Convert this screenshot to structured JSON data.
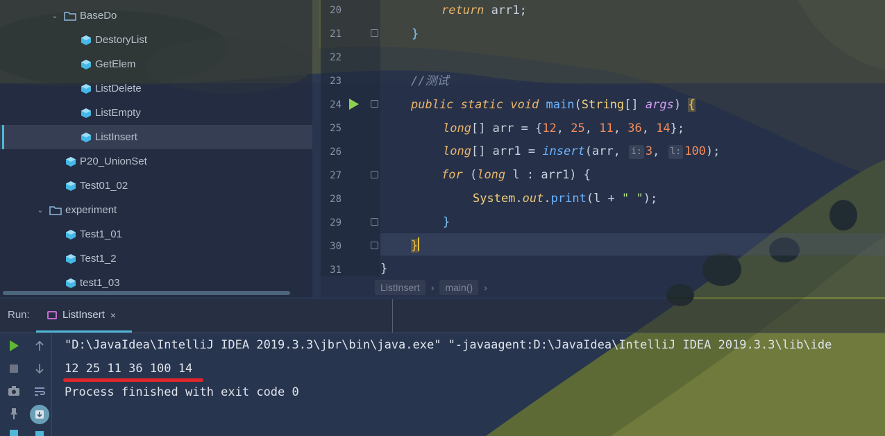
{
  "project_tree": {
    "items": [
      {
        "label": "BaseDo",
        "type": "folder",
        "expanded": true
      },
      {
        "label": "DestoryList",
        "type": "class"
      },
      {
        "label": "GetElem",
        "type": "class"
      },
      {
        "label": "ListDelete",
        "type": "class"
      },
      {
        "label": "ListEmpty",
        "type": "class"
      },
      {
        "label": "ListInsert",
        "type": "class",
        "selected": true
      },
      {
        "label": "P20_UnionSet",
        "type": "class"
      },
      {
        "label": "Test01_02",
        "type": "class"
      },
      {
        "label": "experiment",
        "type": "folder",
        "expanded": true
      },
      {
        "label": "Test1_01",
        "type": "class"
      },
      {
        "label": "Test1_2",
        "type": "class"
      },
      {
        "label": "test1_03",
        "type": "class"
      }
    ]
  },
  "editor": {
    "line_numbers": [
      "20",
      "21",
      "22",
      "23",
      "24",
      "25",
      "26",
      "27",
      "28",
      "29",
      "30",
      "31"
    ],
    "code": {
      "l20_kw": "return",
      "l20_rest": " arr1;",
      "l21": "}",
      "l23_comment": "//测试",
      "l24_public": "public",
      "l24_static": "static",
      "l24_void": "void",
      "l24_main": "main",
      "l24_string": "String",
      "l24_brackets": "[] ",
      "l24_args": "args",
      "l24_close": ") ",
      "l24_brace": "{",
      "l25_long": "long",
      "l25_decl": "[] arr = {",
      "l25_n1": "12",
      "l25_n2": "25",
      "l25_n3": "11",
      "l25_n4": "36",
      "l25_n5": "14",
      "l25_end": "};",
      "l26_long": "long",
      "l26_decl": "[] arr1 = ",
      "l26_insert": "insert",
      "l26_args": "(arr, ",
      "l26_hint_i": "i:",
      "l26_n1": "3",
      "l26_hint_l": "l:",
      "l26_n2": "100",
      "l26_end": ");",
      "l27_for": "for",
      "l27_open": " (",
      "l27_long": "long",
      "l27_rest": " l : arr1) {",
      "l28_system": "System",
      "l28_dot": ".",
      "l28_out": "out",
      "l28_print": "print",
      "l28_open": "(l + ",
      "l28_str": "\" \"",
      "l28_end": ");",
      "l29": "}",
      "l30": "}",
      "l31": "}"
    },
    "breadcrumb": [
      "ListInsert",
      "main()"
    ]
  },
  "run_panel": {
    "label": "Run:",
    "tab_label": "ListInsert",
    "tab_close": "×",
    "console_lines": [
      "\"D:\\JavaIdea\\IntelliJ IDEA 2019.3.3\\jbr\\bin\\java.exe\" \"-javaagent:D:\\JavaIdea\\IntelliJ IDEA 2019.3.3\\lib\\ide",
      "12 25 11 36 100 14",
      "Process finished with exit code 0"
    ]
  },
  "colors": {
    "accent": "#4fb7d8",
    "keyword": "#e9b56a",
    "number": "#f48c5c",
    "underline": "#e0252b",
    "run_green": "#5fb832"
  }
}
